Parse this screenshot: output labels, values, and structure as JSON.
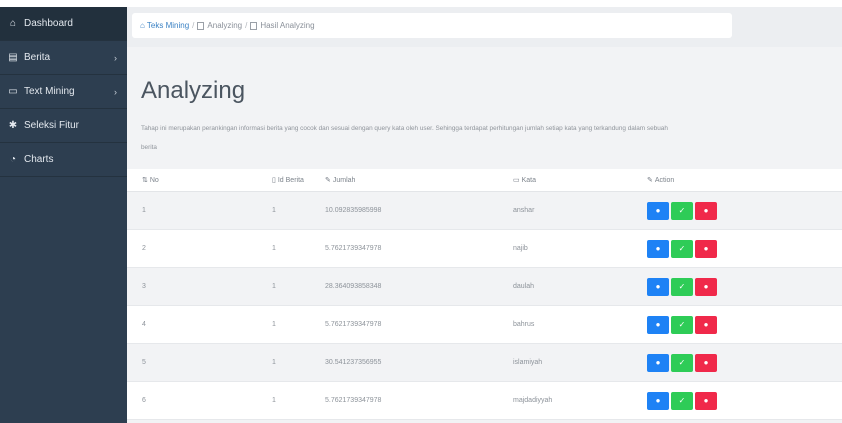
{
  "sidebar": {
    "items": [
      {
        "label": "Dashboard",
        "icon": "home-icon",
        "glyph": "⌂",
        "caret": ""
      },
      {
        "label": "Berita",
        "icon": "newspaper-icon",
        "glyph": "▤",
        "caret": "›"
      },
      {
        "label": "Text Mining",
        "icon": "monitor-icon",
        "glyph": "▭",
        "caret": "›"
      },
      {
        "label": "Seleksi Fitur",
        "icon": "gear-icon",
        "glyph": "✱",
        "caret": ""
      },
      {
        "label": "Charts",
        "icon": "pie-chart-icon",
        "glyph": "◔",
        "caret": ""
      }
    ]
  },
  "breadcrumb": {
    "home": "Teks Mining",
    "item1": "Analyzing",
    "item2": "Hasil Analyzing",
    "sep": "/"
  },
  "page": {
    "title": "Analyzing",
    "description": "Tahap ini merupakan perankingan informasi berita yang cocok dan sesuai dengan query kata oleh user. Sehingga terdapat perhitungan jumlah setiap kata yang terkandung dalam sebuah",
    "description_cont": "berita"
  },
  "table": {
    "headers": [
      {
        "label": "No",
        "icon": "sort-icon",
        "glyph": "⇅"
      },
      {
        "label": "Id Berita",
        "icon": "id-card-icon",
        "glyph": "▯"
      },
      {
        "label": "Jumlah",
        "icon": "pencil-icon",
        "glyph": "✎"
      },
      {
        "label": "Kata",
        "icon": "comment-icon",
        "glyph": "▭"
      },
      {
        "label": "Action",
        "icon": "pencil-icon",
        "glyph": "✎"
      }
    ],
    "rows": [
      {
        "no": "1",
        "id": "1",
        "jumlah": "10.092835985998",
        "kata": "anshar"
      },
      {
        "no": "2",
        "id": "1",
        "jumlah": "5.7621739347978",
        "kata": "najib"
      },
      {
        "no": "3",
        "id": "1",
        "jumlah": "28.364093858348",
        "kata": "daulah"
      },
      {
        "no": "4",
        "id": "1",
        "jumlah": "5.7621739347978",
        "kata": "bahrus"
      },
      {
        "no": "5",
        "id": "1",
        "jumlah": "30.541237356955",
        "kata": "islamiyah"
      },
      {
        "no": "6",
        "id": "1",
        "jumlah": "5.7621739347978",
        "kata": "majdadiyyah"
      }
    ]
  },
  "actions": {
    "view_glyph": "●",
    "edit_glyph": "✓",
    "delete_glyph": "●"
  },
  "colors": {
    "sidebar": "#2d3e50",
    "view_button": "#1e82f5",
    "edit_button": "#2ecc57",
    "delete_button": "#f0294a"
  }
}
